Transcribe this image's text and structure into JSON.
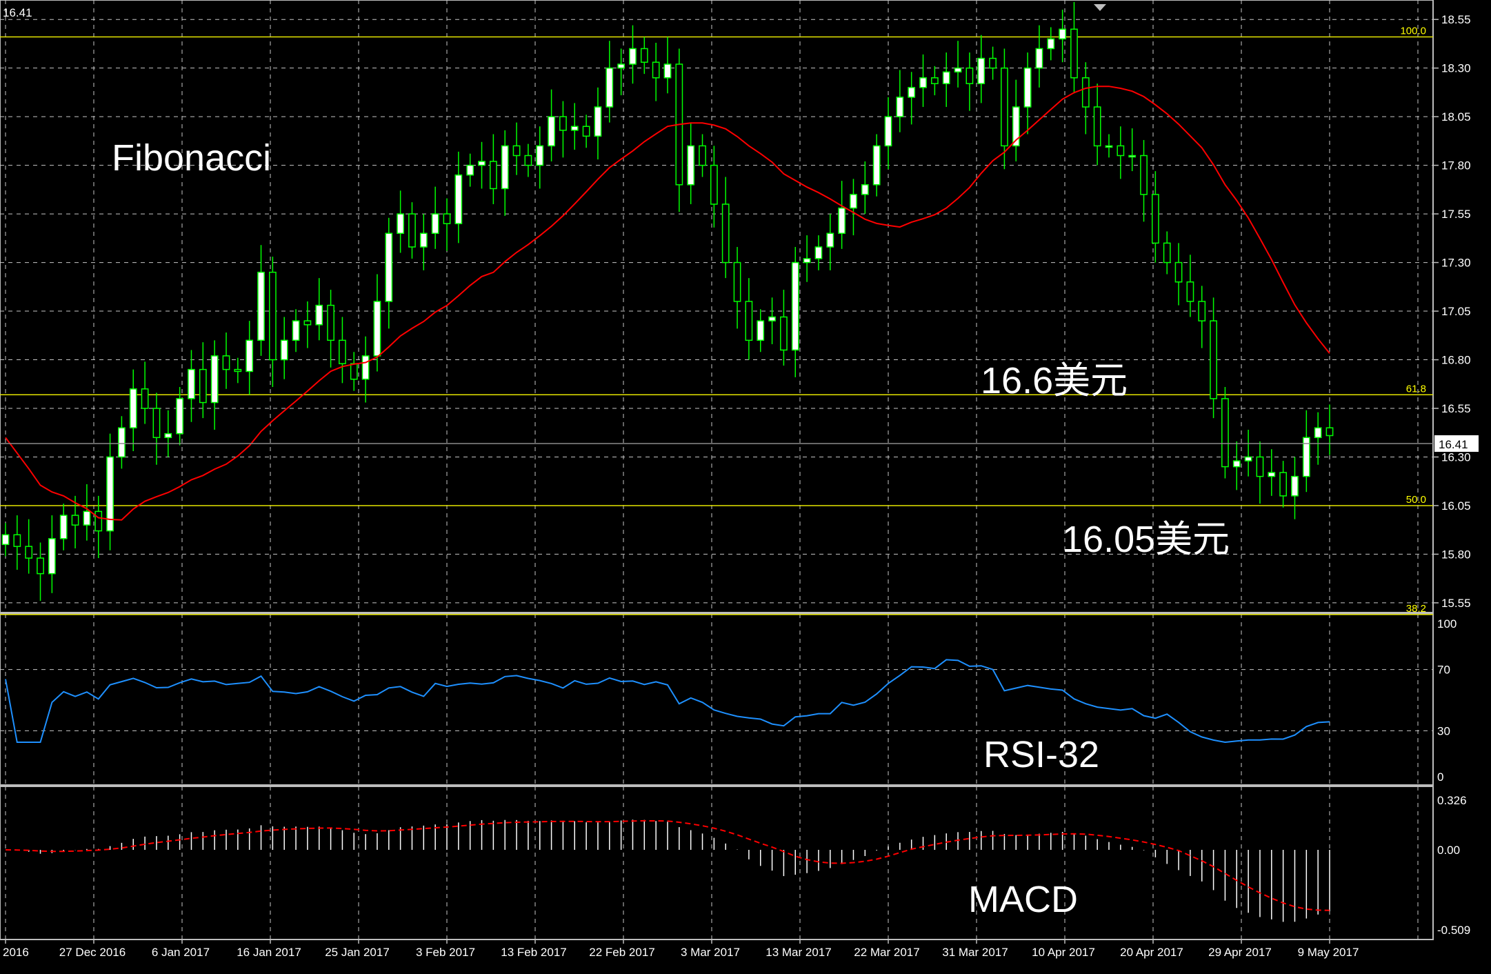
{
  "chart_data": {
    "type": "candlestick",
    "colors": {
      "background": "#000000",
      "grid": "#c8c8c8",
      "bull_candle": "#ffffff",
      "bear_candle": "#000000",
      "wick": "#00ff00",
      "moving_average": "#ff0000",
      "fib_line": "#e5e500",
      "rsi_line": "#1e90ff",
      "macd_hist": "#ffffff",
      "macd_signal": "#ff0000",
      "axis_text": "#ffffff"
    },
    "top_left_label": "16.41",
    "current_price": "16.41",
    "price_axis": {
      "range": [
        15.5,
        18.65
      ],
      "ticks": [
        "18.55",
        "18.30",
        "18.05",
        "17.80",
        "17.55",
        "17.30",
        "17.05",
        "16.80",
        "16.55",
        "16.30",
        "16.05",
        "15.80",
        "15.55"
      ]
    },
    "date_labels": [
      "2016",
      "27 Dec 2016",
      "6 Jan 2017",
      "16 Jan 2017",
      "25 Jan 2017",
      "3 Feb 2017",
      "13 Feb 2017",
      "22 Feb 2017",
      "3 Mar 2017",
      "13 Mar 2017",
      "22 Mar 2017",
      "31 Mar 2017",
      "10 Apr 2017",
      "20 Apr 2017",
      "29 Apr 2017",
      "9 May 2017"
    ],
    "fibonacci": [
      {
        "label": "100.0",
        "price": 18.46
      },
      {
        "label": "61.8",
        "price": 16.62
      },
      {
        "label": "50.0",
        "price": 16.05
      },
      {
        "label": "38.2",
        "price": 15.49
      }
    ],
    "annotations": {
      "title": "Fibonacci",
      "level_high": "16.6美元",
      "level_low": "16.05美元",
      "rsi_title": "RSI-32",
      "macd_title": "MACD"
    },
    "closes": [
      15.9,
      15.84,
      15.78,
      15.7,
      15.88,
      16,
      15.95,
      16.02,
      15.92,
      16.3,
      16.45,
      16.65,
      16.55,
      16.4,
      16.42,
      16.6,
      16.75,
      16.58,
      16.82,
      16.75,
      16.74,
      16.9,
      17.25,
      16.8,
      16.9,
      17.0,
      16.98,
      17.08,
      16.9,
      16.78,
      16.7,
      16.82,
      17.1,
      17.45,
      17.55,
      17.38,
      17.45,
      17.55,
      17.5,
      17.75,
      17.8,
      17.82,
      17.68,
      17.9,
      17.85,
      17.8,
      17.9,
      18.05,
      17.98,
      18.0,
      17.95,
      18.1,
      18.3,
      18.32,
      18.4,
      18.33,
      18.25,
      18.32,
      17.7,
      17.9,
      17.8,
      17.6,
      17.3,
      17.1,
      16.9,
      17.0,
      17.02,
      16.85,
      17.3,
      17.32,
      17.38,
      17.45,
      17.58,
      17.65,
      17.7,
      17.9,
      18.05,
      18.15,
      18.2,
      18.25,
      18.22,
      18.28,
      18.3,
      18.22,
      18.35,
      18.3,
      17.9,
      18.1,
      18.3,
      18.4,
      18.45,
      18.5,
      18.25,
      18.1,
      17.9,
      17.9,
      17.85,
      17.85,
      17.65,
      17.4,
      17.3,
      17.2,
      17.1,
      17.0,
      16.6,
      16.25,
      16.28,
      16.3,
      16.2,
      16.22,
      16.1,
      16.2,
      16.4,
      16.45,
      16.41
    ],
    "macd_scale": {
      "ticks": [
        "0.326",
        "0.00",
        "-0.509"
      ],
      "range": [
        -0.509,
        0.326
      ]
    },
    "rsi_scale": {
      "ticks": [
        "100",
        "70",
        "30",
        "0"
      ]
    }
  }
}
